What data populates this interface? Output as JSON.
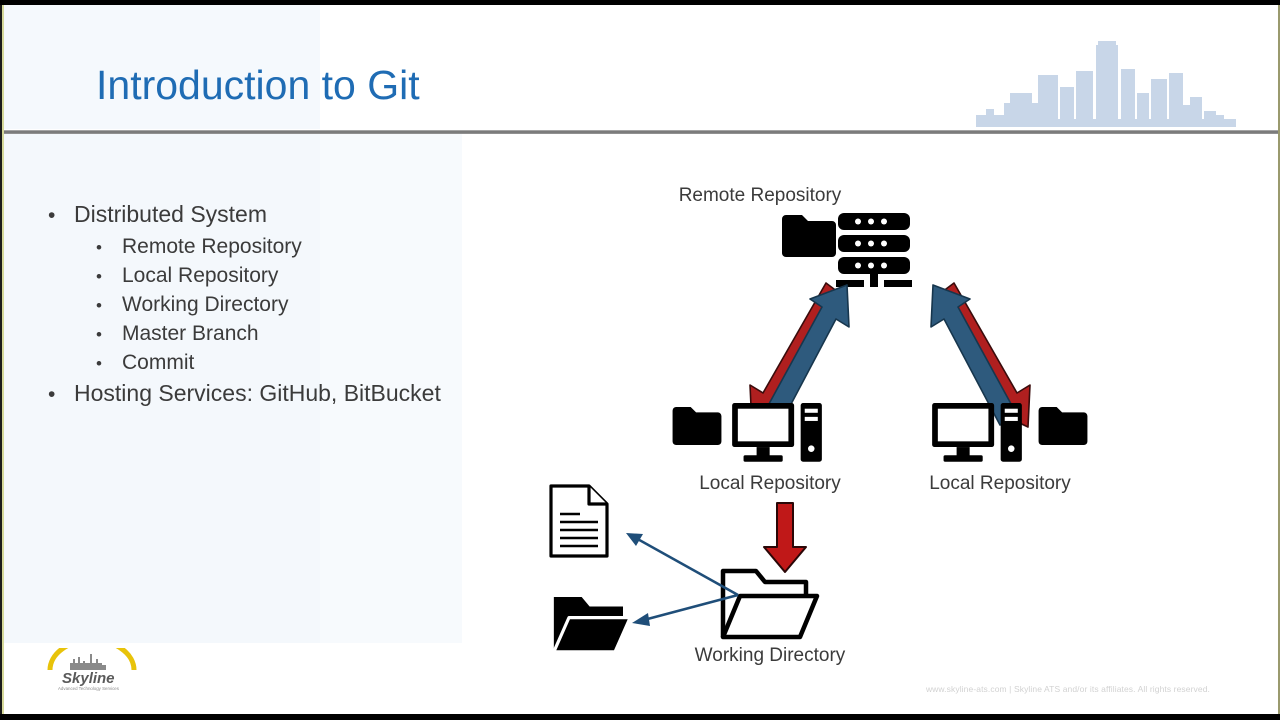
{
  "slide": {
    "title": "Introduction to Git",
    "title_color": "#1f6cb4",
    "background_color": "#ffffff",
    "rule_color": "#6f6f6f"
  },
  "bullets": [
    {
      "level": 1,
      "marker": "•",
      "text": "Distributed System"
    },
    {
      "level": 2,
      "marker": "•",
      "text": "Remote Repository"
    },
    {
      "level": 2,
      "marker": "•",
      "text": "Local Repository"
    },
    {
      "level": 2,
      "marker": "•",
      "text": "Working Directory"
    },
    {
      "level": 2,
      "marker": "•",
      "text": "Master Branch"
    },
    {
      "level": 2,
      "marker": "•",
      "text": "Commit"
    },
    {
      "level": 1,
      "marker": "•",
      "text": "Hosting Services: GitHub, BitBucket"
    }
  ],
  "diagram": {
    "labels": {
      "remote_repository": "Remote Repository",
      "local_repository_left": "Local Repository",
      "local_repository_right": "Local Repository",
      "working_directory": "Working Directory"
    },
    "icons": {
      "remote_folder": "folder-icon",
      "remote_server": "server-rack-icon",
      "local_left_folder": "folder-icon",
      "local_left_computer": "desktop-computer-icon",
      "local_right_computer": "desktop-computer-icon",
      "local_right_folder": "folder-icon",
      "working_folder": "open-folder-outline-icon",
      "document": "document-icon",
      "black_open_folder": "open-folder-icon"
    },
    "arrows": {
      "push_color": "#2e5a7d",
      "pull_color": "#b01f1f",
      "thin_arrow_color": "#1f4e79",
      "left_pull_direction": "down",
      "left_push_direction": "up",
      "right_pull_direction": "down",
      "right_push_direction": "up",
      "checkout_direction": "down"
    }
  },
  "footer": {
    "logo_name": "Skyline",
    "logo_tagline": "Advanced Technology Services",
    "copyright": "www.skyline-ats.com | Skyline ATS and/or its affiliates. All rights reserved."
  }
}
